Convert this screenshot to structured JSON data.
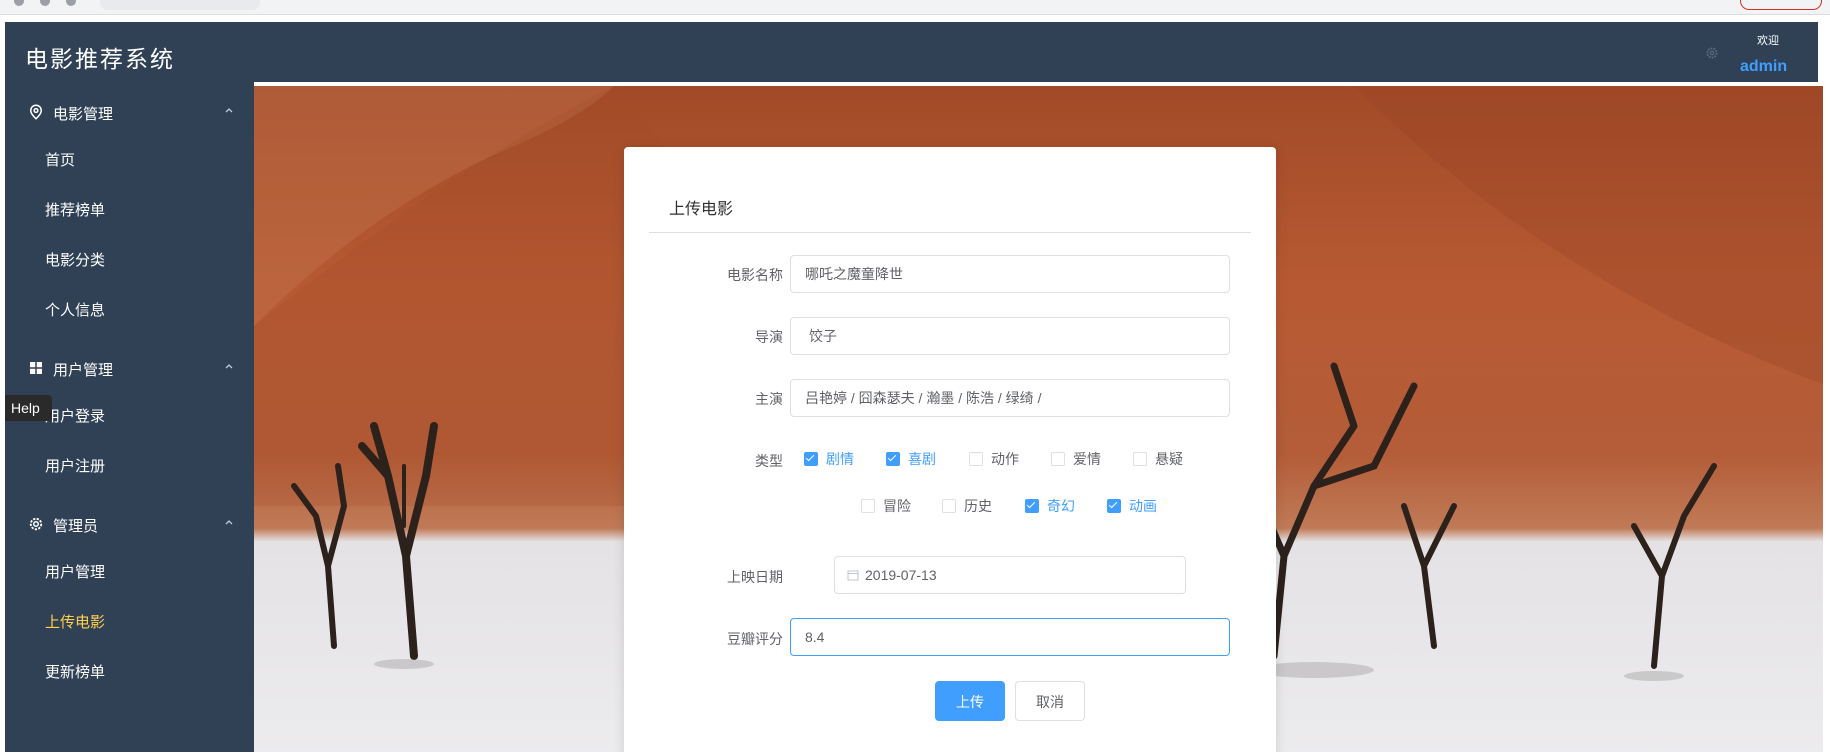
{
  "app": {
    "title": "电影推荐系统",
    "welcome": "欢迎",
    "username": "admin",
    "brand_color": "#304156",
    "accent_color": "#409eff",
    "active_color": "#ffd04b"
  },
  "sidebar": {
    "groups": [
      {
        "label": "电影管理",
        "icon": "location-pin-icon",
        "items": [
          "首页",
          "推荐榜单",
          "电影分类",
          "个人信息"
        ]
      },
      {
        "label": "用户管理",
        "icon": "grid-icon",
        "items": [
          "用户登录",
          "用户注册"
        ]
      },
      {
        "label": "管理员",
        "icon": "gear-icon",
        "items": [
          "用户管理",
          "上传电影",
          "更新榜单"
        ]
      }
    ],
    "active_item": "上传电影"
  },
  "tooltip": {
    "text": "Help"
  },
  "form": {
    "title": "上传电影",
    "fields": {
      "name": {
        "label": "电影名称",
        "value": "哪吒之魔童降世"
      },
      "director": {
        "label": "导演",
        "value": " 饺子"
      },
      "actors": {
        "label": "主演",
        "value": "吕艳婷 / 囧森瑟夫 / 瀚墨 / 陈浩 / 绿绮 /"
      },
      "genre": {
        "label": "类型",
        "options": [
          {
            "label": "剧情",
            "checked": true
          },
          {
            "label": "喜剧",
            "checked": true
          },
          {
            "label": "动作",
            "checked": false
          },
          {
            "label": "爱情",
            "checked": false
          },
          {
            "label": "悬疑",
            "checked": false
          },
          {
            "label": "冒险",
            "checked": false
          },
          {
            "label": "历史",
            "checked": false
          },
          {
            "label": "奇幻",
            "checked": true
          },
          {
            "label": "动画",
            "checked": true
          }
        ]
      },
      "release_date": {
        "label": "上映日期",
        "value": "2019-07-13",
        "icon": "calendar-icon"
      },
      "douban_score": {
        "label": "豆瓣评分",
        "value": "8.4"
      }
    },
    "buttons": {
      "upload": "上传",
      "cancel": "取消"
    }
  }
}
